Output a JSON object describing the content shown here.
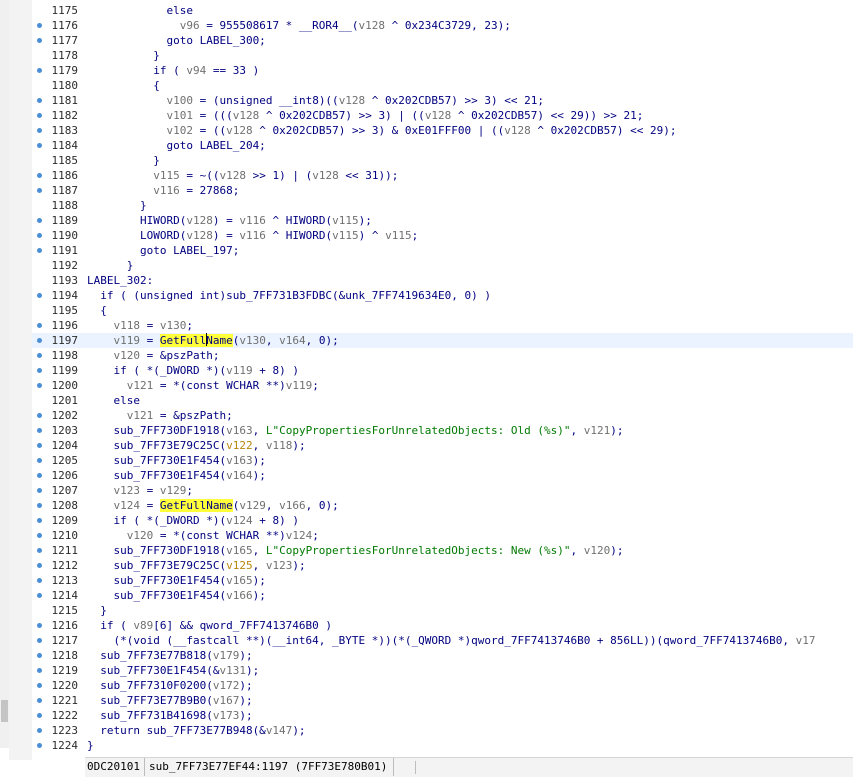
{
  "lines": [
    {
      "n": "1175",
      "dot": false,
      "t": [
        [
          "k",
          "            else"
        ]
      ]
    },
    {
      "n": "1176",
      "dot": true,
      "t": [
        [
          "k",
          "              "
        ],
        [
          "v",
          "v96"
        ],
        [
          "k",
          " = 955508617 * __ROR4__("
        ],
        [
          "v",
          "v128"
        ],
        [
          "k",
          " ^ 0x234C3729, 23);"
        ]
      ]
    },
    {
      "n": "1177",
      "dot": true,
      "t": [
        [
          "k",
          "            goto LABEL_300;"
        ]
      ]
    },
    {
      "n": "1178",
      "dot": false,
      "t": [
        [
          "k",
          "          }"
        ]
      ]
    },
    {
      "n": "1179",
      "dot": true,
      "t": [
        [
          "k",
          "          if ( "
        ],
        [
          "v",
          "v94"
        ],
        [
          "k",
          " == 33 )"
        ]
      ]
    },
    {
      "n": "1180",
      "dot": false,
      "t": [
        [
          "k",
          "          {"
        ]
      ]
    },
    {
      "n": "1181",
      "dot": true,
      "t": [
        [
          "k",
          "            "
        ],
        [
          "v",
          "v100"
        ],
        [
          "k",
          " = (unsigned __int8)(("
        ],
        [
          "v",
          "v128"
        ],
        [
          "k",
          " ^ 0x202CDB57) >> 3) << 21;"
        ]
      ]
    },
    {
      "n": "1182",
      "dot": true,
      "t": [
        [
          "k",
          "            "
        ],
        [
          "v",
          "v101"
        ],
        [
          "k",
          " = ((("
        ],
        [
          "v",
          "v128"
        ],
        [
          "k",
          " ^ 0x202CDB57) >> 3) | (("
        ],
        [
          "v",
          "v128"
        ],
        [
          "k",
          " ^ 0x202CDB57) << 29)) >> 21;"
        ]
      ]
    },
    {
      "n": "1183",
      "dot": true,
      "t": [
        [
          "k",
          "            "
        ],
        [
          "v",
          "v102"
        ],
        [
          "k",
          " = (("
        ],
        [
          "v",
          "v128"
        ],
        [
          "k",
          " ^ 0x202CDB57) >> 3) & 0xE01FFF00 | (("
        ],
        [
          "v",
          "v128"
        ],
        [
          "k",
          " ^ 0x202CDB57) << 29);"
        ]
      ]
    },
    {
      "n": "1184",
      "dot": true,
      "t": [
        [
          "k",
          "            goto LABEL_204;"
        ]
      ]
    },
    {
      "n": "1185",
      "dot": false,
      "t": [
        [
          "k",
          "          }"
        ]
      ]
    },
    {
      "n": "1186",
      "dot": true,
      "t": [
        [
          "k",
          "          "
        ],
        [
          "v",
          "v115"
        ],
        [
          "k",
          " = ~(("
        ],
        [
          "v",
          "v128"
        ],
        [
          "k",
          " >> 1) | ("
        ],
        [
          "v",
          "v128"
        ],
        [
          "k",
          " << 31));"
        ]
      ]
    },
    {
      "n": "1187",
      "dot": true,
      "t": [
        [
          "k",
          "          "
        ],
        [
          "v",
          "v116"
        ],
        [
          "k",
          " = 27868;"
        ]
      ]
    },
    {
      "n": "1188",
      "dot": false,
      "t": [
        [
          "k",
          "        }"
        ]
      ]
    },
    {
      "n": "1189",
      "dot": true,
      "t": [
        [
          "k",
          "        HIWORD("
        ],
        [
          "v",
          "v128"
        ],
        [
          "k",
          ") = "
        ],
        [
          "v",
          "v116"
        ],
        [
          "k",
          " ^ HIWORD("
        ],
        [
          "v",
          "v115"
        ],
        [
          "k",
          ");"
        ]
      ]
    },
    {
      "n": "1190",
      "dot": true,
      "t": [
        [
          "k",
          "        LOWORD("
        ],
        [
          "v",
          "v128"
        ],
        [
          "k",
          ") = "
        ],
        [
          "v",
          "v116"
        ],
        [
          "k",
          " ^ HIWORD("
        ],
        [
          "v",
          "v115"
        ],
        [
          "k",
          ") ^ "
        ],
        [
          "v",
          "v115"
        ],
        [
          "k",
          ";"
        ]
      ]
    },
    {
      "n": "1191",
      "dot": true,
      "t": [
        [
          "k",
          "        goto LABEL_197;"
        ]
      ]
    },
    {
      "n": "1192",
      "dot": false,
      "t": [
        [
          "k",
          "      }"
        ]
      ]
    },
    {
      "n": "1193",
      "dot": false,
      "t": [
        [
          "k",
          "LABEL_302:"
        ]
      ]
    },
    {
      "n": "1194",
      "dot": true,
      "t": [
        [
          "k",
          "  if ( (unsigned int)sub_7FF731B3FDBC(&unk_7FF7419634E0, 0) )"
        ]
      ]
    },
    {
      "n": "1195",
      "dot": false,
      "t": [
        [
          "k",
          "  {"
        ]
      ]
    },
    {
      "n": "1196",
      "dot": true,
      "t": [
        [
          "k",
          "    "
        ],
        [
          "v",
          "v118"
        ],
        [
          "k",
          " = "
        ],
        [
          "v",
          "v130"
        ],
        [
          "k",
          ";"
        ]
      ]
    },
    {
      "n": "1197",
      "dot": true,
      "current": true,
      "t": [
        [
          "k",
          "    "
        ],
        [
          "v",
          "v119"
        ],
        [
          "k",
          " = "
        ],
        [
          "h",
          "GetFullName"
        ],
        [
          "k",
          "("
        ],
        [
          "v",
          "v130"
        ],
        [
          "k",
          ", "
        ],
        [
          "v",
          "v164"
        ],
        [
          "k",
          ", 0);"
        ]
      ]
    },
    {
      "n": "1198",
      "dot": true,
      "t": [
        [
          "k",
          "    "
        ],
        [
          "v",
          "v120"
        ],
        [
          "k",
          " = &pszPath;"
        ]
      ]
    },
    {
      "n": "1199",
      "dot": true,
      "t": [
        [
          "k",
          "    if ( *(_DWORD *)("
        ],
        [
          "v",
          "v119"
        ],
        [
          "k",
          " + 8) )"
        ]
      ]
    },
    {
      "n": "1200",
      "dot": true,
      "t": [
        [
          "k",
          "      "
        ],
        [
          "v",
          "v121"
        ],
        [
          "k",
          " = *(const WCHAR **)"
        ],
        [
          "v",
          "v119"
        ],
        [
          "k",
          ";"
        ]
      ]
    },
    {
      "n": "1201",
      "dot": false,
      "t": [
        [
          "k",
          "    else"
        ]
      ]
    },
    {
      "n": "1202",
      "dot": true,
      "t": [
        [
          "k",
          "      "
        ],
        [
          "v",
          "v121"
        ],
        [
          "k",
          " = &pszPath;"
        ]
      ]
    },
    {
      "n": "1203",
      "dot": true,
      "t": [
        [
          "k",
          "    sub_7FF730DF1918("
        ],
        [
          "v",
          "v163"
        ],
        [
          "k",
          ", "
        ],
        [
          "s",
          "L\"CopyPropertiesForUnrelatedObjects: Old (%s)\""
        ],
        [
          "k",
          ", "
        ],
        [
          "v",
          "v121"
        ],
        [
          "k",
          ");"
        ]
      ]
    },
    {
      "n": "1204",
      "dot": true,
      "t": [
        [
          "k",
          "    sub_7FF73E79C25C("
        ],
        [
          "o",
          "v122"
        ],
        [
          "k",
          ", "
        ],
        [
          "v",
          "v118"
        ],
        [
          "k",
          ");"
        ]
      ]
    },
    {
      "n": "1205",
      "dot": true,
      "t": [
        [
          "k",
          "    sub_7FF730E1F454("
        ],
        [
          "v",
          "v163"
        ],
        [
          "k",
          ");"
        ]
      ]
    },
    {
      "n": "1206",
      "dot": true,
      "t": [
        [
          "k",
          "    sub_7FF730E1F454("
        ],
        [
          "v",
          "v164"
        ],
        [
          "k",
          ");"
        ]
      ]
    },
    {
      "n": "1207",
      "dot": true,
      "t": [
        [
          "k",
          "    "
        ],
        [
          "v",
          "v123"
        ],
        [
          "k",
          " = "
        ],
        [
          "v",
          "v129"
        ],
        [
          "k",
          ";"
        ]
      ]
    },
    {
      "n": "1208",
      "dot": true,
      "t": [
        [
          "k",
          "    "
        ],
        [
          "v",
          "v124"
        ],
        [
          "k",
          " = "
        ],
        [
          "h",
          "GetFullName"
        ],
        [
          "k",
          "("
        ],
        [
          "v",
          "v129"
        ],
        [
          "k",
          ", "
        ],
        [
          "v",
          "v166"
        ],
        [
          "k",
          ", 0);"
        ]
      ]
    },
    {
      "n": "1209",
      "dot": true,
      "t": [
        [
          "k",
          "    if ( *(_DWORD *)("
        ],
        [
          "v",
          "v124"
        ],
        [
          "k",
          " + 8) )"
        ]
      ]
    },
    {
      "n": "1210",
      "dot": true,
      "t": [
        [
          "k",
          "      "
        ],
        [
          "v",
          "v120"
        ],
        [
          "k",
          " = *(const WCHAR **)"
        ],
        [
          "v",
          "v124"
        ],
        [
          "k",
          ";"
        ]
      ]
    },
    {
      "n": "1211",
      "dot": true,
      "t": [
        [
          "k",
          "    sub_7FF730DF1918("
        ],
        [
          "v",
          "v165"
        ],
        [
          "k",
          ", "
        ],
        [
          "s",
          "L\"CopyPropertiesForUnrelatedObjects: New (%s)\""
        ],
        [
          "k",
          ", "
        ],
        [
          "v",
          "v120"
        ],
        [
          "k",
          ");"
        ]
      ]
    },
    {
      "n": "1212",
      "dot": true,
      "t": [
        [
          "k",
          "    sub_7FF73E79C25C("
        ],
        [
          "o",
          "v125"
        ],
        [
          "k",
          ", "
        ],
        [
          "v",
          "v123"
        ],
        [
          "k",
          ");"
        ]
      ]
    },
    {
      "n": "1213",
      "dot": true,
      "t": [
        [
          "k",
          "    sub_7FF730E1F454("
        ],
        [
          "v",
          "v165"
        ],
        [
          "k",
          ");"
        ]
      ]
    },
    {
      "n": "1214",
      "dot": true,
      "t": [
        [
          "k",
          "    sub_7FF730E1F454("
        ],
        [
          "v",
          "v166"
        ],
        [
          "k",
          ");"
        ]
      ]
    },
    {
      "n": "1215",
      "dot": false,
      "t": [
        [
          "k",
          "  }"
        ]
      ]
    },
    {
      "n": "1216",
      "dot": true,
      "t": [
        [
          "k",
          "  if ( "
        ],
        [
          "v",
          "v89"
        ],
        [
          "k",
          "[6] && qword_7FF7413746B0 )"
        ]
      ]
    },
    {
      "n": "1217",
      "dot": true,
      "t": [
        [
          "k",
          "    (*(void (__fastcall **)(__int64, _BYTE *))(*(_QWORD *)qword_7FF7413746B0 + 856LL))(qword_7FF7413746B0, "
        ],
        [
          "v",
          "v17"
        ]
      ]
    },
    {
      "n": "1218",
      "dot": true,
      "t": [
        [
          "k",
          "  sub_7FF73E77B818("
        ],
        [
          "v",
          "v179"
        ],
        [
          "k",
          ");"
        ]
      ]
    },
    {
      "n": "1219",
      "dot": true,
      "t": [
        [
          "k",
          "  sub_7FF730E1F454(&"
        ],
        [
          "v",
          "v131"
        ],
        [
          "k",
          ");"
        ]
      ]
    },
    {
      "n": "1220",
      "dot": true,
      "t": [
        [
          "k",
          "  sub_7FF7310F0200("
        ],
        [
          "v",
          "v172"
        ],
        [
          "k",
          ");"
        ]
      ]
    },
    {
      "n": "1221",
      "dot": true,
      "t": [
        [
          "k",
          "  sub_7FF73E77B9B0("
        ],
        [
          "v",
          "v167"
        ],
        [
          "k",
          ");"
        ]
      ]
    },
    {
      "n": "1222",
      "dot": true,
      "t": [
        [
          "k",
          "  sub_7FF731B41698("
        ],
        [
          "v",
          "v173"
        ],
        [
          "k",
          ");"
        ]
      ]
    },
    {
      "n": "1223",
      "dot": true,
      "t": [
        [
          "k",
          "  return sub_7FF73E77B948(&"
        ],
        [
          "v",
          "v147"
        ],
        [
          "k",
          ");"
        ]
      ]
    },
    {
      "n": "1224",
      "dot": true,
      "t": [
        [
          "k",
          "}"
        ]
      ]
    }
  ],
  "status": {
    "offset": "0DC20101",
    "location": "sub_7FF73E77EF44:1197 (7FF73E780B01)"
  },
  "colors": {
    "code": "#000080",
    "variable": "#707070",
    "highlight": "#ffff3a",
    "string": "#007a00",
    "dot": "#4a8fd6"
  }
}
